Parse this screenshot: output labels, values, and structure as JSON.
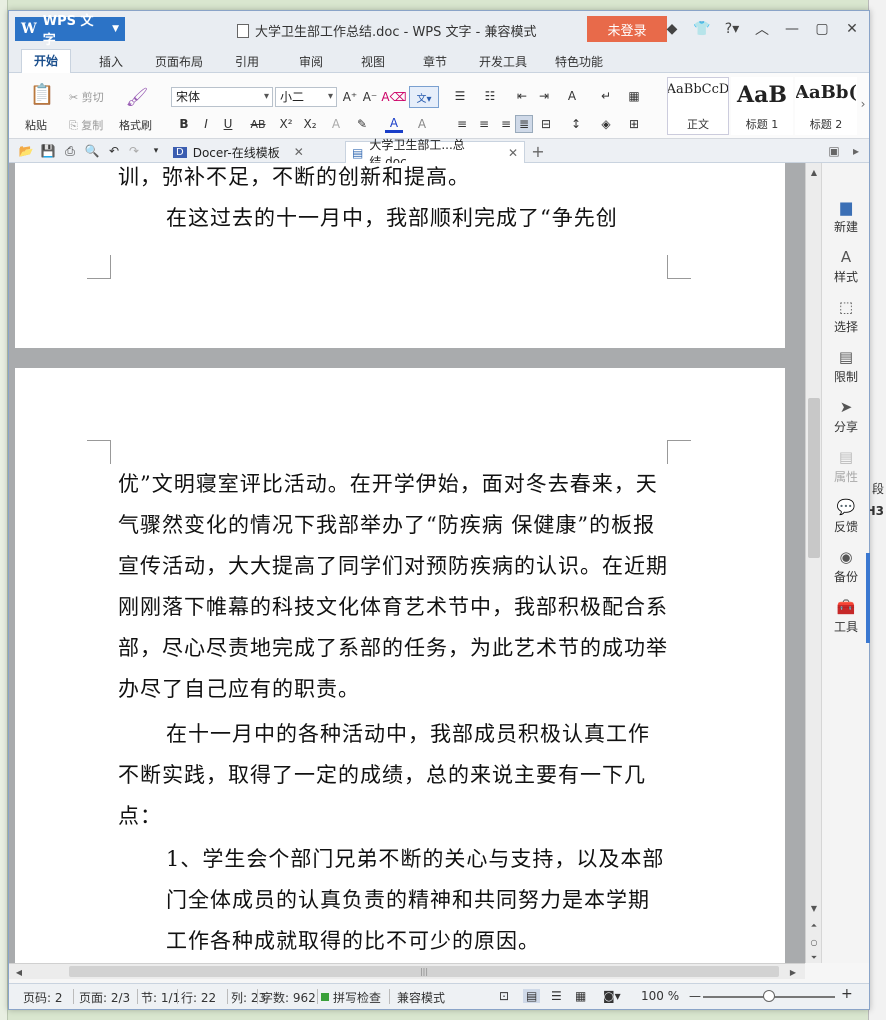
{
  "window": {
    "app_button": "WPS 文字",
    "title": "大学卫生部工作总结.doc - WPS 文字 - 兼容模式",
    "login": "未登录"
  },
  "ribbon_tabs": [
    "开始",
    "插入",
    "页面布局",
    "引用",
    "审阅",
    "视图",
    "章节",
    "开发工具",
    "特色功能"
  ],
  "ribbon": {
    "paste": "粘贴",
    "cut": "剪切",
    "copy": "复制",
    "format_painter": "格式刷",
    "font_name": "宋体",
    "font_size": "小二",
    "bold": "B",
    "italic": "I",
    "underline": "U",
    "strike": "AB",
    "superscript": "X²",
    "subscript": "X₂",
    "styles": [
      {
        "preview": "AaBbCcD",
        "name": "正文"
      },
      {
        "preview": "AaB",
        "name": "标题 1"
      },
      {
        "preview": "AaBb(",
        "name": "标题 2"
      }
    ]
  },
  "doc_tabs": {
    "tab1": "Docer-在线模板",
    "tab2": "大学卫生部工...总结.doc",
    "add": "+"
  },
  "document": {
    "page1_lines": [
      "训，弥补不足，不断的创新和提高。",
      "在这过去的十一月中，我部顺利完成了“争先创"
    ],
    "p1": "优”文明寝室评比活动。在开学伊始，面对冬去春来，天气骤然变化的情况下我部举办了“防疾病 保健康”的板报宣传活动，大大提高了同学们对预防疾病的认识。在近期刚刚落下帷幕的科技文化体育艺术节中，我部积极配合系部，尽心尽责地完成了系部的任务，为此艺术节的成功举办尽了自己应有的职责。",
    "p2": "在十一月中的各种活动中，我部成员积极认真工作不断实践，取得了一定的成绩，总的来说主要有一下几点：",
    "p3": "1、学生会个部门兄弟不断的关心与支持，以及本部门全体成员的认真负责的精神和共同努力是本学期工作各种成就取得的比不可少的原因。"
  },
  "side_panel": [
    "新建",
    "样式",
    "选择",
    "限制",
    "分享",
    "属性",
    "反馈",
    "备份",
    "工具"
  ],
  "status": {
    "page_code": "页码: 2",
    "pages": "页面: 2/3",
    "section": "节: 1/1",
    "row": "行: 22",
    "col": "列: 23",
    "word_count": "字数: 962",
    "spell_check": "拼写检查",
    "compat_mode": "兼容模式",
    "zoom": "100 %"
  },
  "background_right": {
    "t1": "段",
    "t2": "H3"
  }
}
